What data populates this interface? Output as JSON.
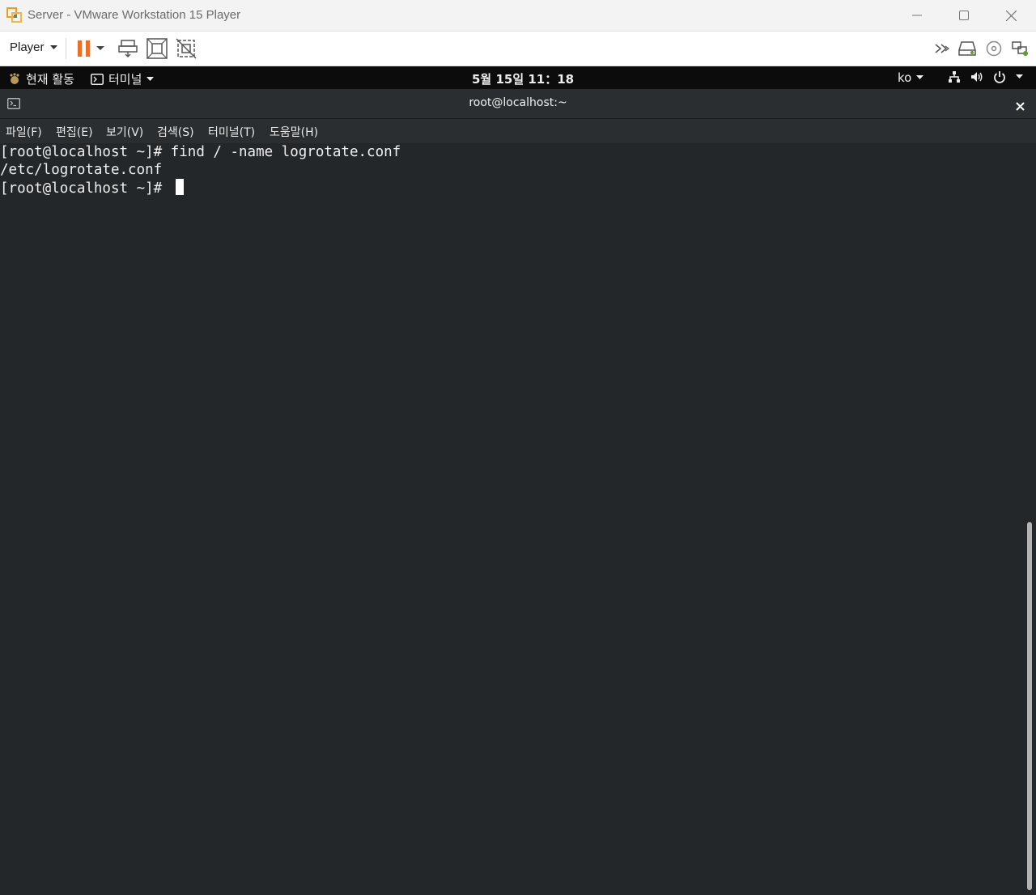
{
  "window": {
    "title": "Server - VMware Workstation 15 Player",
    "controls": [
      "minimize-icon",
      "maximize-icon",
      "close-icon"
    ]
  },
  "vm_toolbar": {
    "player_label": "Player",
    "accent_color": "#e8702a",
    "left_icons": [
      "pause-icon",
      "dropdown-arrow-icon",
      "send-ctrl-alt-del-icon",
      "full-screen-icon",
      "unity-icon"
    ],
    "right_icons": [
      "more-devices-icon",
      "hard-disk-icon",
      "cd-dvd-icon",
      "network-adapter-icon"
    ]
  },
  "gnome_bar": {
    "activities_label": "현재 활동",
    "app_menu_label": "터미널",
    "clock": "5월 15일  11：18",
    "input_method": "ko"
  },
  "terminal": {
    "title": "root@localhost:~",
    "menu": [
      "파일(F)",
      "편집(E)",
      "보기(V)",
      "검색(S)",
      "터미널(T)",
      "도움말(H)"
    ],
    "lines": [
      "[root@localhost ~]# find / -name logrotate.conf",
      "/etc/logrotate.conf",
      "[root@localhost ~]# "
    ],
    "background": "#24272a",
    "foreground": "#eeeeee"
  }
}
